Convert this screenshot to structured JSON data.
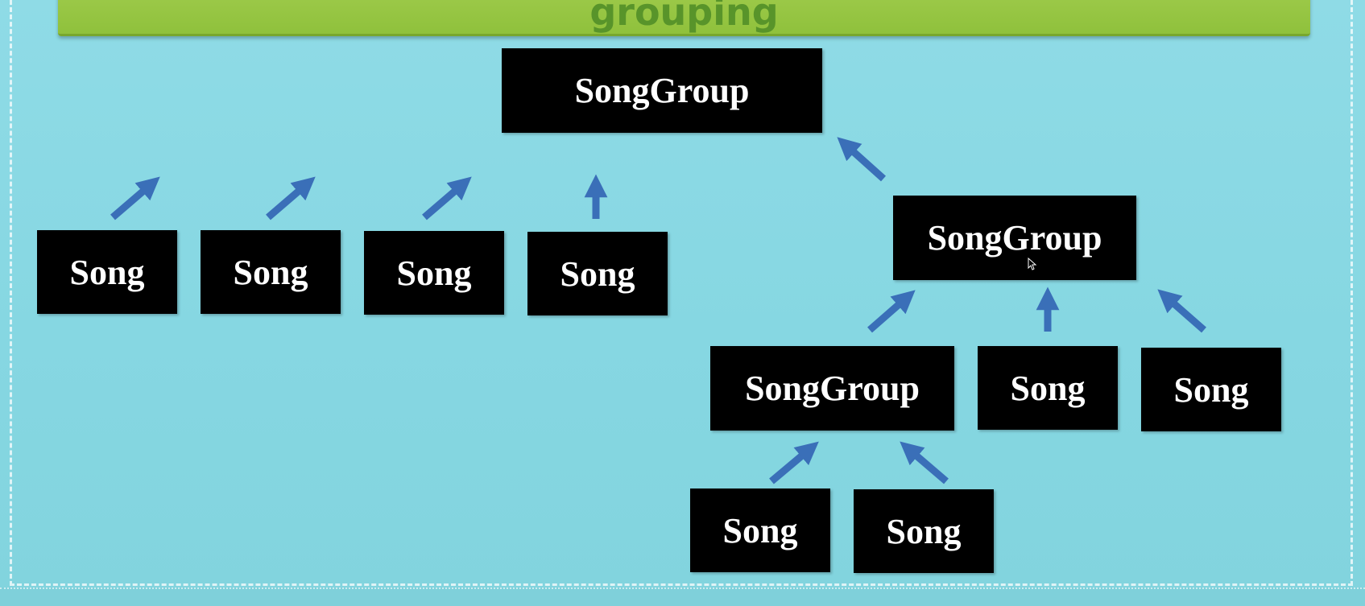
{
  "banner": {
    "title": "grouping"
  },
  "diagram": {
    "arrow_color": "#3a6fb8",
    "node_color": "#000000",
    "text_color": "#ffffff",
    "nodes": {
      "root": "SongGroup",
      "song1": "Song",
      "song2": "Song",
      "song3": "Song",
      "song4": "Song",
      "group2": "SongGroup",
      "group3": "SongGroup",
      "song5": "Song",
      "song6": "Song",
      "song7": "Song",
      "song8": "Song"
    }
  }
}
